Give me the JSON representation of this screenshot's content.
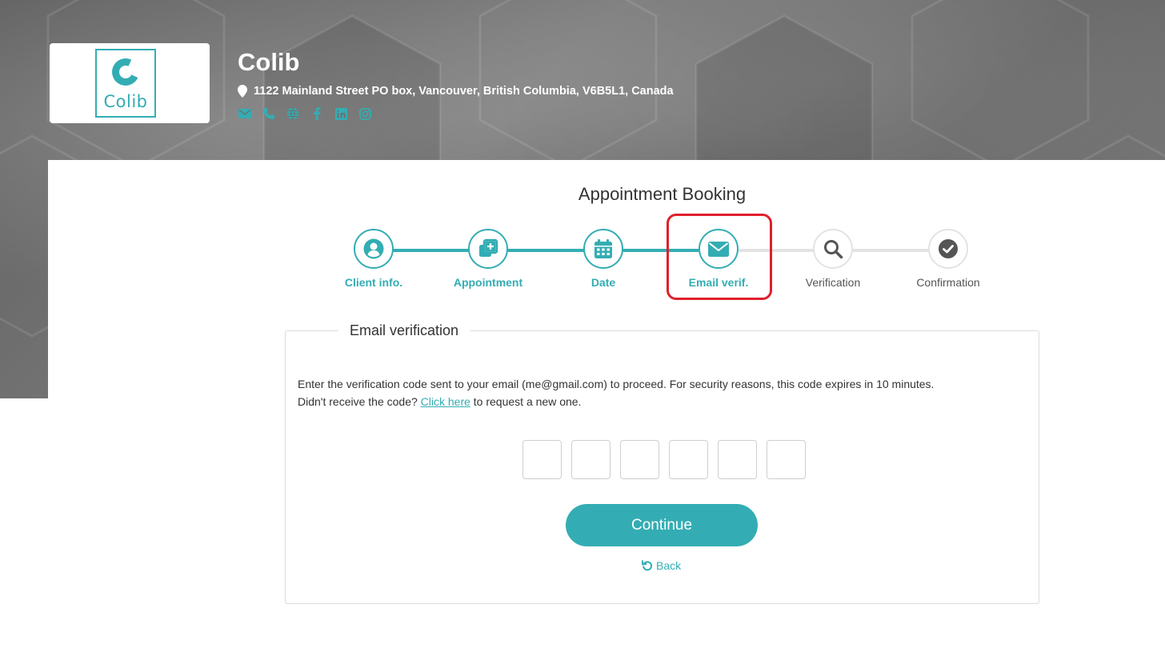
{
  "company": {
    "name": "Colib",
    "logo_text": "Colib",
    "address": "1122 Mainland Street PO box, Vancouver, British Columbia, V6B5L1, Canada",
    "social_icons": [
      "email-icon",
      "phone-icon",
      "globe-icon",
      "facebook-icon",
      "linkedin-icon",
      "instagram-icon"
    ]
  },
  "booking": {
    "title": "Appointment Booking",
    "steps": [
      {
        "label": "Client info.",
        "icon": "user-icon",
        "state": "done"
      },
      {
        "label": "Appointment",
        "icon": "add-copy-icon",
        "state": "done"
      },
      {
        "label": "Date",
        "icon": "calendar-icon",
        "state": "done"
      },
      {
        "label": "Email verif.",
        "icon": "envelope-icon",
        "state": "current"
      },
      {
        "label": "Verification",
        "icon": "search-icon",
        "state": "pending"
      },
      {
        "label": "Confirmation",
        "icon": "check-circle-icon",
        "state": "pending"
      }
    ]
  },
  "email_verification": {
    "legend": "Email verification",
    "line1": "Enter the verification code sent to your email (me@gmail.com) to proceed. For security reasons, this code expires in 10 minutes.",
    "line2_prefix": "Didn't receive the code? ",
    "line2_link": "Click here",
    "line2_suffix": " to request a new one.",
    "code_length": 6,
    "continue_label": "Continue",
    "back_label": "Back"
  },
  "colors": {
    "accent": "#33adb3",
    "highlight": "#e0202c",
    "inactive": "#e3e3e3"
  }
}
